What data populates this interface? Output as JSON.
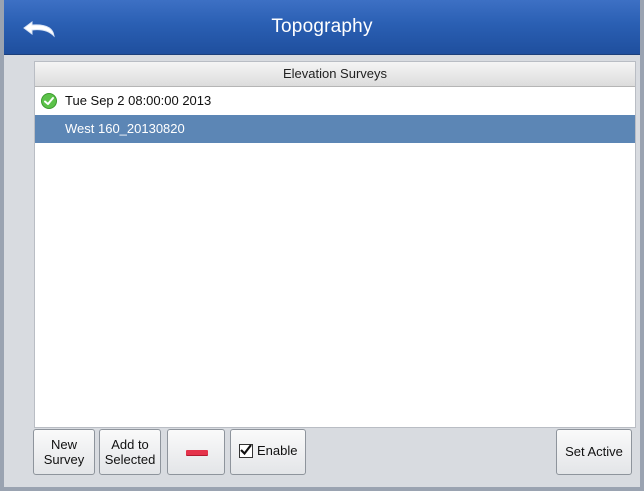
{
  "window": {
    "title": "Topography"
  },
  "list": {
    "header": "Elevation Surveys",
    "items": [
      {
        "label": "Tue Sep 2 08:00:00 2013",
        "status_icon": "green-check-icon",
        "selected": false
      },
      {
        "label": "West 160_20130820",
        "selected": true
      }
    ]
  },
  "toolbar": {
    "new_survey_line1": "New",
    "new_survey_line2": "Survey",
    "add_selected_line1": "Add to",
    "add_selected_line2": "Selected",
    "remove_icon": "remove-icon",
    "enable_label": "Enable",
    "enable_checked": true,
    "set_active_label": "Set Active"
  },
  "colors": {
    "titlebar": "#2a5fb3",
    "selected_row": "#5c86b5",
    "remove_red": "#e5334b"
  }
}
